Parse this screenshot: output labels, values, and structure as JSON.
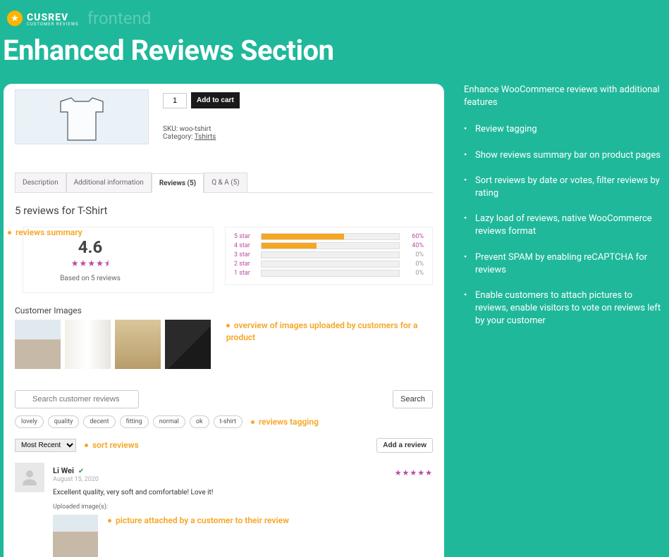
{
  "header": {
    "logo_text": "CUSREV",
    "logo_sub": "CUSTOMER REVIEWS",
    "breadcrumb": "frontend",
    "page_title": "Enhanced Reviews Section"
  },
  "product": {
    "quantity": "1",
    "add_to_cart": "Add to cart",
    "sku_label": "SKU:",
    "sku_value": "woo-tshirt",
    "category_label": "Category:",
    "category_value": "Tshirts"
  },
  "tabs": [
    {
      "label": "Description"
    },
    {
      "label": "Additional information"
    },
    {
      "label": "Reviews (5)"
    },
    {
      "label": "Q & A (5)"
    }
  ],
  "reviews": {
    "heading": "5 reviews for T-Shirt",
    "summary_annot": "reviews summary",
    "rating": "4.6",
    "based_on": "Based on 5 reviews",
    "bars": [
      {
        "label": "5 star",
        "pct": "60%",
        "width": 60
      },
      {
        "label": "4 star",
        "pct": "40%",
        "width": 40
      },
      {
        "label": "3 star",
        "pct": "0%",
        "width": 0
      },
      {
        "label": "2 star",
        "pct": "0%",
        "width": 0
      },
      {
        "label": "1 star",
        "pct": "0%",
        "width": 0
      }
    ],
    "cust_images_heading": "Customer Images",
    "images_annot": "overview of images uploaded by customers for a product",
    "search_placeholder": "Search customer reviews",
    "search_button": "Search",
    "tags": [
      "lovely",
      "quality",
      "decent",
      "fitting",
      "normal",
      "ok",
      "t-shirt"
    ],
    "tags_annot": "reviews tagging",
    "sort_options": [
      "Most Recent"
    ],
    "sort_annot": "sort reviews",
    "add_review": "Add a review",
    "review": {
      "author": "Li Wei",
      "date": "August 15, 2020",
      "text": "Excellent quality, very soft and comfortable! Love it!",
      "uploaded_label": "Uploaded image(s):",
      "attached_annot": "picture attached by a customer to their review"
    }
  },
  "sidebar": {
    "lead": "Enhance WooCommerce reviews with additional features",
    "features": [
      "Review tagging",
      "Show reviews summary bar on product pages",
      "Sort reviews by date or votes, filter reviews by rating",
      "Lazy load of reviews, native WooCommerce reviews format",
      "Prevent SPAM by enabling reCAPTCHA for reviews",
      "Enable customers to attach pictures to reviews, enable visitors to vote on reviews left by your customer"
    ]
  }
}
